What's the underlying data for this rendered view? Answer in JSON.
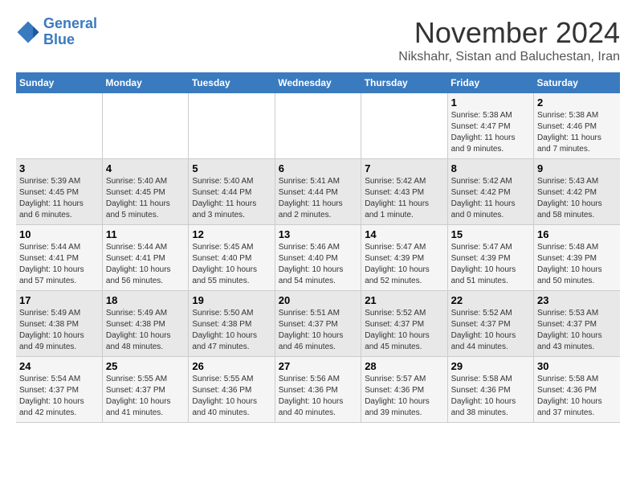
{
  "header": {
    "logo_line1": "General",
    "logo_line2": "Blue",
    "month": "November 2024",
    "location": "Nikshahr, Sistan and Baluchestan, Iran"
  },
  "weekdays": [
    "Sunday",
    "Monday",
    "Tuesday",
    "Wednesday",
    "Thursday",
    "Friday",
    "Saturday"
  ],
  "weeks": [
    [
      {
        "day": "",
        "info": ""
      },
      {
        "day": "",
        "info": ""
      },
      {
        "day": "",
        "info": ""
      },
      {
        "day": "",
        "info": ""
      },
      {
        "day": "",
        "info": ""
      },
      {
        "day": "1",
        "info": "Sunrise: 5:38 AM\nSunset: 4:47 PM\nDaylight: 11 hours\nand 9 minutes."
      },
      {
        "day": "2",
        "info": "Sunrise: 5:38 AM\nSunset: 4:46 PM\nDaylight: 11 hours\nand 7 minutes."
      }
    ],
    [
      {
        "day": "3",
        "info": "Sunrise: 5:39 AM\nSunset: 4:45 PM\nDaylight: 11 hours\nand 6 minutes."
      },
      {
        "day": "4",
        "info": "Sunrise: 5:40 AM\nSunset: 4:45 PM\nDaylight: 11 hours\nand 5 minutes."
      },
      {
        "day": "5",
        "info": "Sunrise: 5:40 AM\nSunset: 4:44 PM\nDaylight: 11 hours\nand 3 minutes."
      },
      {
        "day": "6",
        "info": "Sunrise: 5:41 AM\nSunset: 4:44 PM\nDaylight: 11 hours\nand 2 minutes."
      },
      {
        "day": "7",
        "info": "Sunrise: 5:42 AM\nSunset: 4:43 PM\nDaylight: 11 hours\nand 1 minute."
      },
      {
        "day": "8",
        "info": "Sunrise: 5:42 AM\nSunset: 4:42 PM\nDaylight: 11 hours\nand 0 minutes."
      },
      {
        "day": "9",
        "info": "Sunrise: 5:43 AM\nSunset: 4:42 PM\nDaylight: 10 hours\nand 58 minutes."
      }
    ],
    [
      {
        "day": "10",
        "info": "Sunrise: 5:44 AM\nSunset: 4:41 PM\nDaylight: 10 hours\nand 57 minutes."
      },
      {
        "day": "11",
        "info": "Sunrise: 5:44 AM\nSunset: 4:41 PM\nDaylight: 10 hours\nand 56 minutes."
      },
      {
        "day": "12",
        "info": "Sunrise: 5:45 AM\nSunset: 4:40 PM\nDaylight: 10 hours\nand 55 minutes."
      },
      {
        "day": "13",
        "info": "Sunrise: 5:46 AM\nSunset: 4:40 PM\nDaylight: 10 hours\nand 54 minutes."
      },
      {
        "day": "14",
        "info": "Sunrise: 5:47 AM\nSunset: 4:39 PM\nDaylight: 10 hours\nand 52 minutes."
      },
      {
        "day": "15",
        "info": "Sunrise: 5:47 AM\nSunset: 4:39 PM\nDaylight: 10 hours\nand 51 minutes."
      },
      {
        "day": "16",
        "info": "Sunrise: 5:48 AM\nSunset: 4:39 PM\nDaylight: 10 hours\nand 50 minutes."
      }
    ],
    [
      {
        "day": "17",
        "info": "Sunrise: 5:49 AM\nSunset: 4:38 PM\nDaylight: 10 hours\nand 49 minutes."
      },
      {
        "day": "18",
        "info": "Sunrise: 5:49 AM\nSunset: 4:38 PM\nDaylight: 10 hours\nand 48 minutes."
      },
      {
        "day": "19",
        "info": "Sunrise: 5:50 AM\nSunset: 4:38 PM\nDaylight: 10 hours\nand 47 minutes."
      },
      {
        "day": "20",
        "info": "Sunrise: 5:51 AM\nSunset: 4:37 PM\nDaylight: 10 hours\nand 46 minutes."
      },
      {
        "day": "21",
        "info": "Sunrise: 5:52 AM\nSunset: 4:37 PM\nDaylight: 10 hours\nand 45 minutes."
      },
      {
        "day": "22",
        "info": "Sunrise: 5:52 AM\nSunset: 4:37 PM\nDaylight: 10 hours\nand 44 minutes."
      },
      {
        "day": "23",
        "info": "Sunrise: 5:53 AM\nSunset: 4:37 PM\nDaylight: 10 hours\nand 43 minutes."
      }
    ],
    [
      {
        "day": "24",
        "info": "Sunrise: 5:54 AM\nSunset: 4:37 PM\nDaylight: 10 hours\nand 42 minutes."
      },
      {
        "day": "25",
        "info": "Sunrise: 5:55 AM\nSunset: 4:37 PM\nDaylight: 10 hours\nand 41 minutes."
      },
      {
        "day": "26",
        "info": "Sunrise: 5:55 AM\nSunset: 4:36 PM\nDaylight: 10 hours\nand 40 minutes."
      },
      {
        "day": "27",
        "info": "Sunrise: 5:56 AM\nSunset: 4:36 PM\nDaylight: 10 hours\nand 40 minutes."
      },
      {
        "day": "28",
        "info": "Sunrise: 5:57 AM\nSunset: 4:36 PM\nDaylight: 10 hours\nand 39 minutes."
      },
      {
        "day": "29",
        "info": "Sunrise: 5:58 AM\nSunset: 4:36 PM\nDaylight: 10 hours\nand 38 minutes."
      },
      {
        "day": "30",
        "info": "Sunrise: 5:58 AM\nSunset: 4:36 PM\nDaylight: 10 hours\nand 37 minutes."
      }
    ]
  ]
}
